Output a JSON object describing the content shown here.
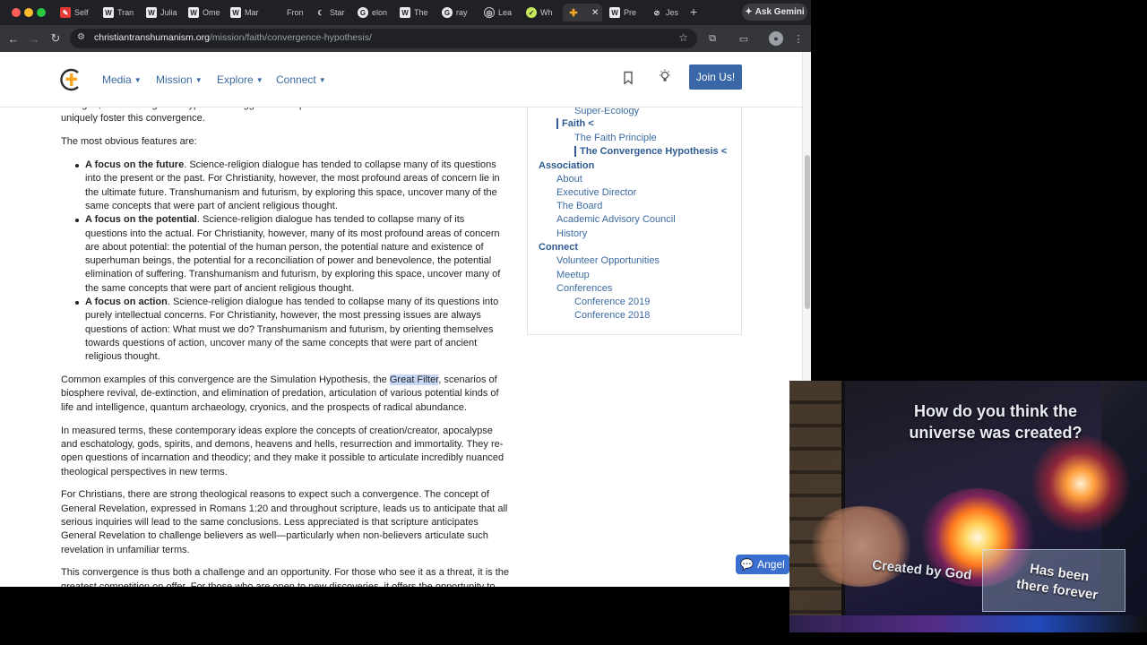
{
  "browser": {
    "tabs": [
      {
        "icon": "pin-icon",
        "label": "Self"
      },
      {
        "icon": "wikipedia-icon",
        "label": "Tran"
      },
      {
        "icon": "wikipedia-icon",
        "label": "Julia"
      },
      {
        "icon": "wikipedia-icon",
        "label": "Ome"
      },
      {
        "icon": "wikipedia-icon",
        "label": "Mar"
      },
      {
        "icon": "blank-icon",
        "label": "Fron"
      },
      {
        "icon": "moon-icon",
        "label": "Star"
      },
      {
        "icon": "google-icon",
        "label": "elon"
      },
      {
        "icon": "wikipedia-icon",
        "label": "The"
      },
      {
        "icon": "google-icon",
        "label": "ray"
      },
      {
        "icon": "globe-icon",
        "label": "Lea"
      },
      {
        "icon": "check-icon",
        "label": "Wh"
      },
      {
        "icon": "christian-transhumanism-icon",
        "label": ""
      },
      {
        "icon": "wikipedia-icon",
        "label": "Pre"
      },
      {
        "icon": "compass-icon",
        "label": "Jes"
      }
    ],
    "gemini_label": "Ask Gemini",
    "url_host": "christiantranshumanism.org",
    "url_path": "/mission/faith/convergence-hypothesis/"
  },
  "header": {
    "menu": [
      "Media",
      "Mission",
      "Explore",
      "Connect"
    ],
    "join_label": "Join Us!"
  },
  "article": {
    "intro_fragment": "dialogue, the Convergence Hypothesis suggests that specific features of transhumanism and futurism uniquely foster this convergence.",
    "features_intro": "The most obvious features are:",
    "features": [
      {
        "title": "A focus on the future",
        "text": ". Science-religion dialogue has tended to collapse many of its questions into the present or the past. For Christianity, however, the most profound areas of concern lie in the ultimate future. Transhumanism and futurism, by exploring this space, uncover many of the same concepts that were part of ancient religious thought."
      },
      {
        "title": "A focus on the potential",
        "text": ". Science-religion dialogue has tended to collapse many of its questions into the actual. For Christianity, however, many of its most profound areas of concern are about potential: the potential of the human person, the potential nature and existence of superhuman beings, the potential for a reconciliation of power and benevolence, the potential elimination of suffering. Transhumanism and futurism, by exploring this space, uncover many of the same concepts that were part of ancient religious thought."
      },
      {
        "title": "A focus on action",
        "text": ". Science-religion dialogue has tended to collapse many of its questions into purely intellectual concerns. For Christianity, however, the most pressing issues are always questions of action: What must we do? Transhumanism and futurism, by orienting themselves towards questions of action, uncover many of the same concepts that were part of ancient religious thought."
      }
    ],
    "examples_before": "Common examples of this convergence are the Simulation Hypothesis, the ",
    "examples_highlight": "Great Filter",
    "examples_after": ", scenarios of biosphere revival, de-extinction, and elimination of predation, articulation of various potential kinds of life and intelligence, quantum archaeology, cryonics, and the prospects of radical abundance.",
    "measured": "In measured terms, these contemporary ideas explore the concepts of creation/creator, apocalypse and eschatology, gods, spirits, and demons, heavens and hells, resurrection and immortality. They re-open questions of incarnation and theodicy; and they make it possible to articulate incredibly nuanced theological perspectives in new terms.",
    "christians": "For Christians, there are strong theological reasons to expect such a convergence. The concept of General Revelation, expressed in Romans 1:20 and throughout scripture, leads us to anticipate that all serious inquiries will lead to the same conclusions. Less appreciated is that scripture anticipates General Revelation to challenge believers as well—particularly when non-believers articulate such revelation in unfamiliar terms.",
    "last": "This convergence is thus both a challenge and an opportunity. For those who see it as a threat, it is the greatest competition on offer. For those who are open to new discoveries, it offers the opportunity to"
  },
  "sidebar": {
    "super_ecology": "Super-Ecology",
    "faith": "Faith <",
    "faith_principle": "The Faith Principle",
    "convergence": "The Convergence Hypothesis <",
    "association": "Association",
    "about": "About",
    "executive_director": "Executive Director",
    "board": "The Board",
    "advisory": "Academic Advisory Council",
    "history": "History",
    "connect": "Connect",
    "volunteer": "Volunteer Opportunities",
    "meetup": "Meetup",
    "conferences": "Conferences",
    "conf2019": "Conference 2019",
    "conf2018": "Conference 2018"
  },
  "chat": {
    "label": "Angel"
  },
  "video": {
    "question": "How do you think the universe was created?",
    "option1": "Created by God",
    "option2": "Has been there forever"
  },
  "colors": {
    "accent": "#3a67a8",
    "link": "#3b6aa0",
    "highlight": "#c7d7f5",
    "logo_orange": "#f5a623"
  }
}
